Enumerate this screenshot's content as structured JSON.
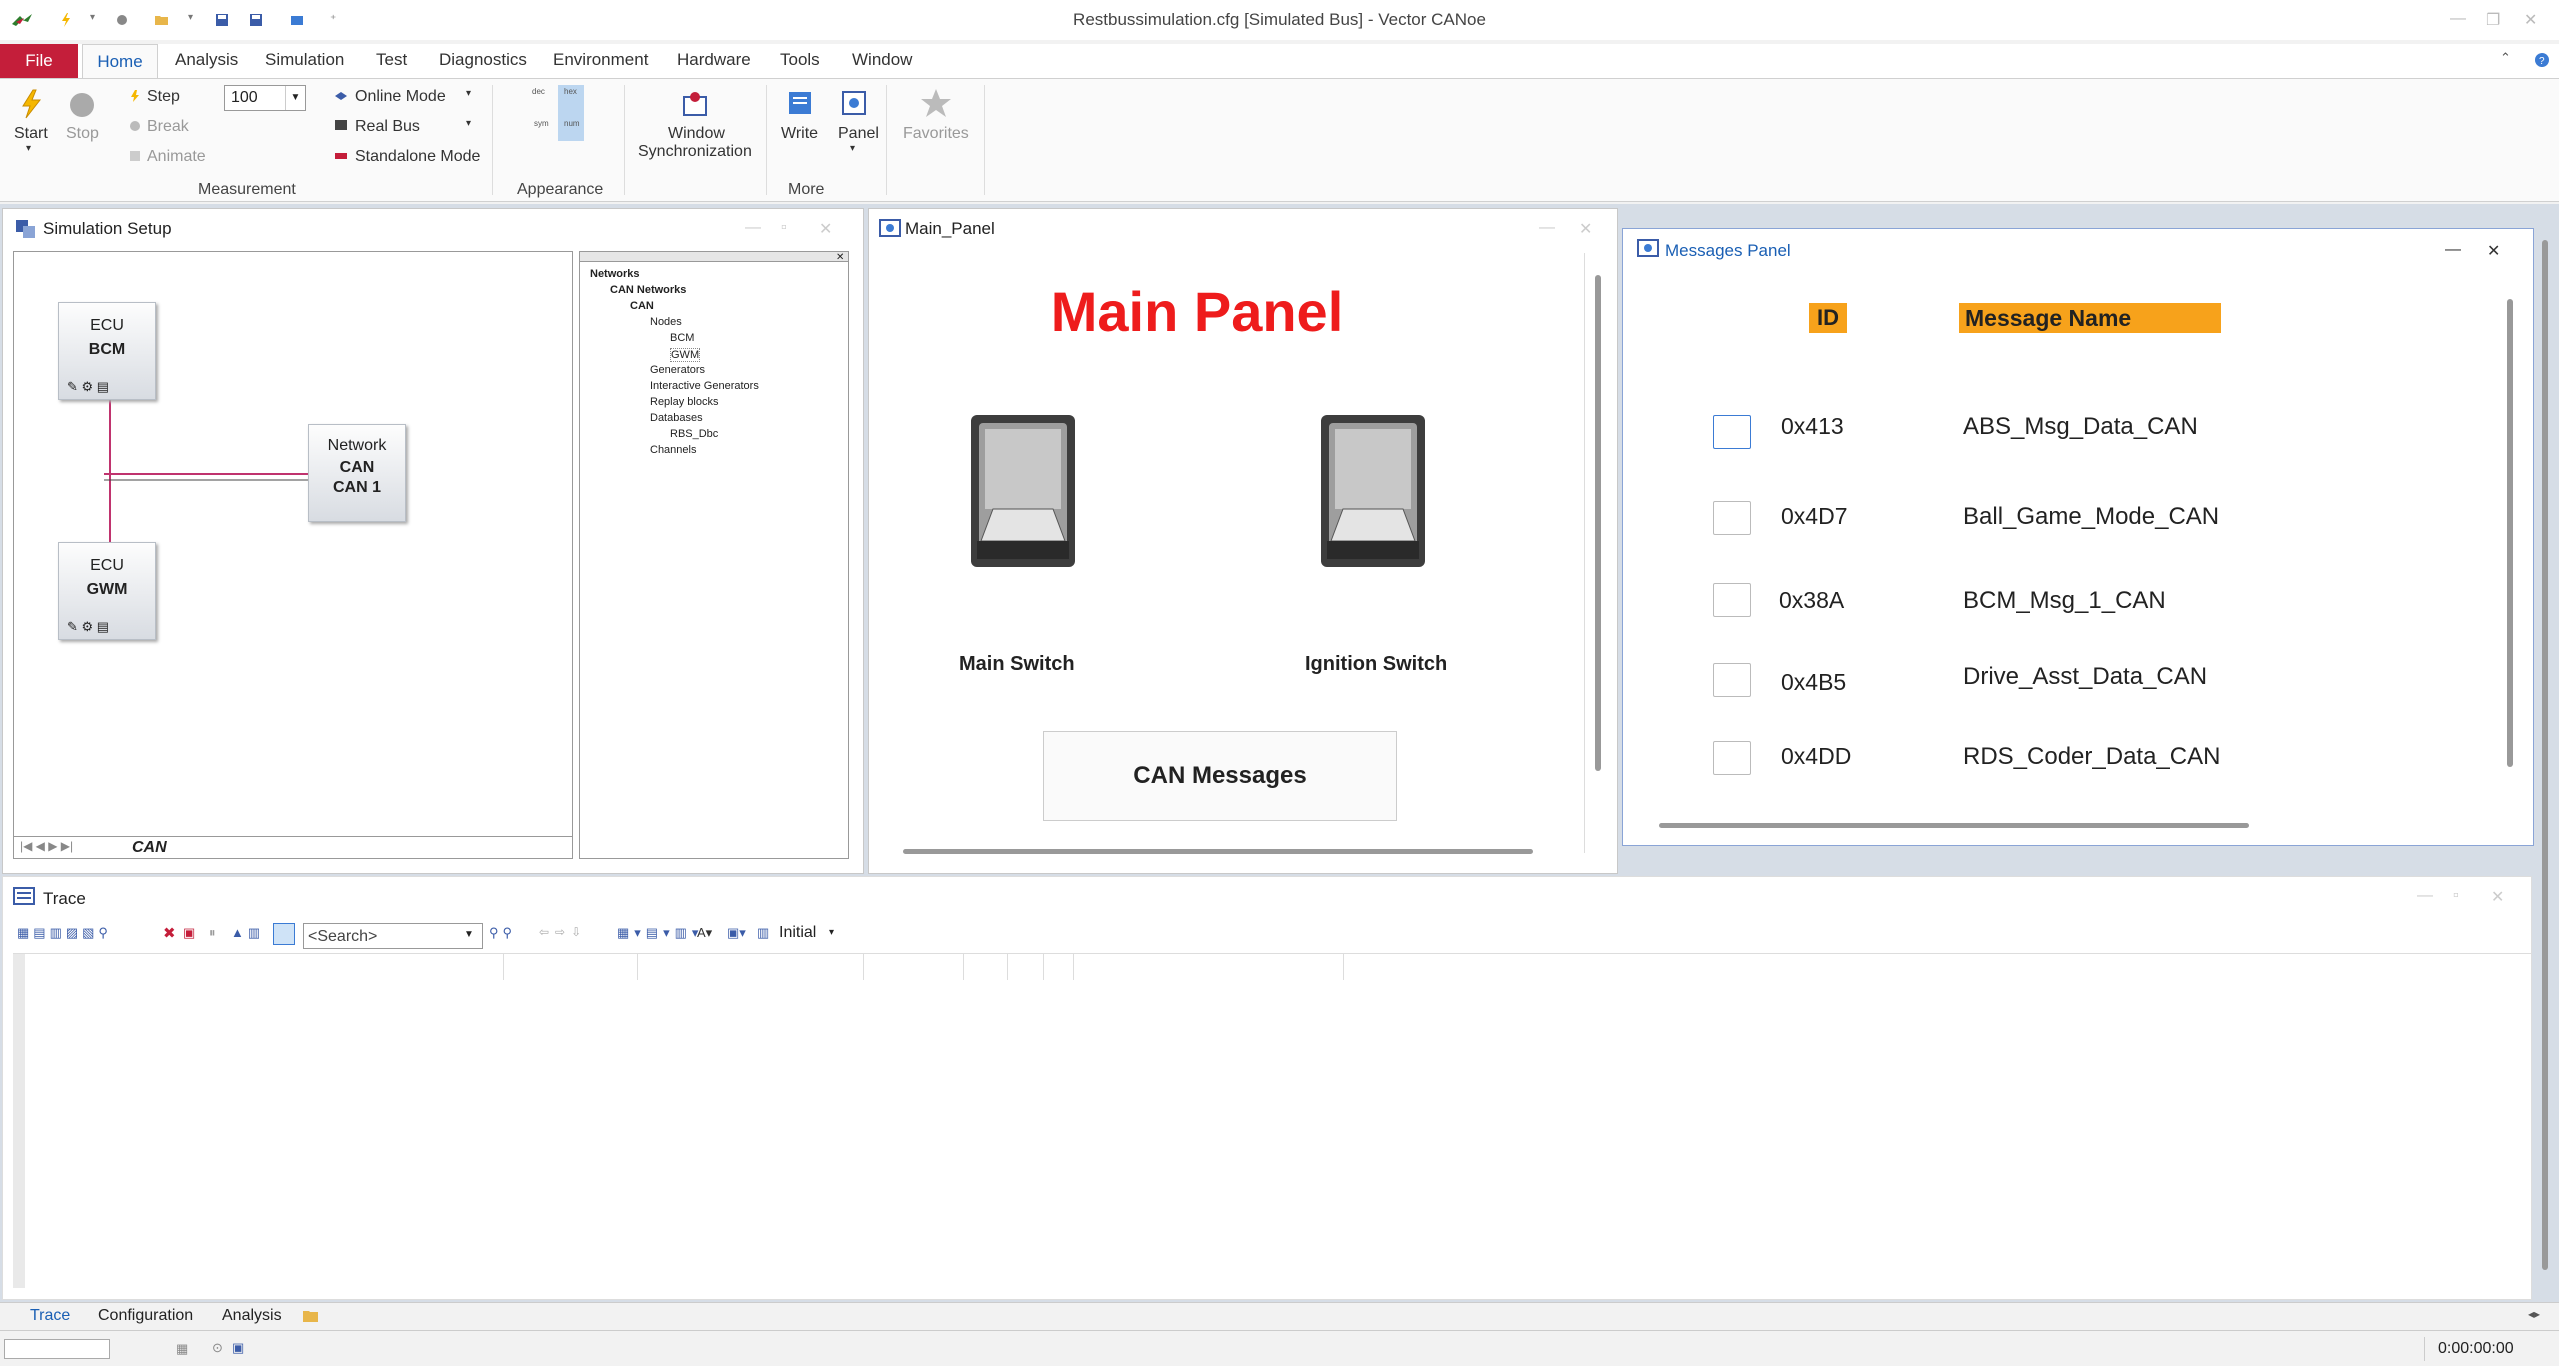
{
  "window": {
    "title": "Restbussimulation.cfg [Simulated Bus] - Vector CANoe"
  },
  "ribbon_tabs": [
    "File",
    "Home",
    "Analysis",
    "Simulation",
    "Test",
    "Diagnostics",
    "Environment",
    "Hardware",
    "Tools",
    "Window"
  ],
  "ribbon": {
    "start": "Start",
    "stop": "Stop",
    "step": "Step",
    "break": "Break",
    "animate": "Animate",
    "speed_value": "100",
    "online_mode": "Online Mode",
    "real_bus": "Real Bus",
    "standalone_mode": "Standalone Mode",
    "measurement_group": "Measurement",
    "appearance_group": "Appearance",
    "appearance_buttons": [
      "dec",
      "hex",
      "sym",
      "num"
    ],
    "window_sync_1": "Window",
    "window_sync_2": "Synchronization",
    "write": "Write",
    "panel": "Panel",
    "favorites": "Favorites",
    "more_group": "More"
  },
  "simulation_setup": {
    "title": "Simulation Setup",
    "ecu_bcm": {
      "line1": "ECU",
      "line2": "BCM"
    },
    "ecu_gwm": {
      "line1": "ECU",
      "line2": "GWM"
    },
    "network": {
      "line1": "Network",
      "line2": "CAN",
      "line3": "CAN 1"
    },
    "tab": "CAN",
    "tree": [
      "Networks",
      "CAN Networks",
      "CAN",
      "Nodes",
      "BCM",
      "GWM",
      "Generators",
      "Interactive Generators",
      "Replay blocks",
      "Databases",
      "RBS_Dbc",
      "Channels"
    ]
  },
  "main_panel": {
    "window_title": "Main_Panel",
    "heading": "Main Panel",
    "switch1": "Main Switch",
    "switch2": "Ignition Switch",
    "button": "CAN Messages",
    "heading_color": "#ee1c1c"
  },
  "messages_panel": {
    "title": "Messages Panel",
    "col_id": "ID",
    "col_name": "Message Name",
    "header_color": "#f7a21b",
    "rows": [
      {
        "id": "0x413",
        "name": "ABS_Msg_Data_CAN"
      },
      {
        "id": "0x4D7",
        "name": "Ball_Game_Mode_CAN"
      },
      {
        "id": "0x38A",
        "name": "BCM_Msg_1_CAN"
      },
      {
        "id": "0x4B5",
        "name": "Drive_Asst_Data_CAN"
      },
      {
        "id": "0x4DD",
        "name": "RDS_Coder_Data_CAN"
      }
    ]
  },
  "trace": {
    "title": "Trace",
    "search_placeholder": "<Search>",
    "filter_label": "Initial"
  },
  "bottom_tabs": [
    "Trace",
    "Configuration",
    "Analysis"
  ],
  "status": {
    "time": "0:00:00:00"
  }
}
